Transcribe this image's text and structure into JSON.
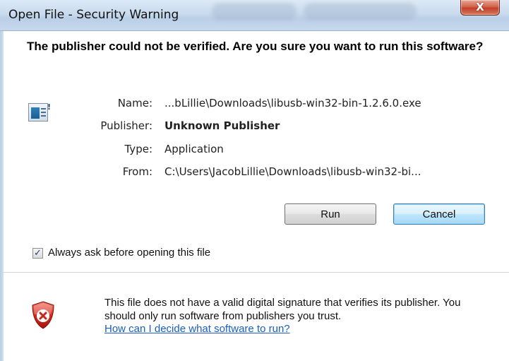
{
  "window": {
    "title": "Open File - Security Warning",
    "close_label": "X"
  },
  "dialog": {
    "heading": "The publisher could not be verified.  Are you sure you want to run this software?",
    "file_info": {
      "name_label": "Name:",
      "name_value": "...bLillie\\Downloads\\libusb-win32-bin-1.2.6.0.exe",
      "publisher_label": "Publisher:",
      "publisher_value": "Unknown Publisher",
      "type_label": "Type:",
      "type_value": "Application",
      "from_label": "From:",
      "from_value": "C:\\Users\\JacobLillie\\Downloads\\libusb-win32-bi..."
    },
    "buttons": {
      "run_label": "Run",
      "cancel_label": "Cancel"
    },
    "checkbox": {
      "label": "Always ask before opening this file",
      "checked": true
    },
    "warning": {
      "text": "This file does not have a valid digital signature that verifies its publisher.  You should only run software from publishers you trust.",
      "link_text": "How can I decide what software to run?"
    }
  },
  "icons": {
    "file": "application-icon",
    "warning": "security-shield-error-icon",
    "check": "checkmark-icon"
  },
  "colors": {
    "link": "#1a5ec2",
    "shield_red": "#d52b1e",
    "default_button_border": "#3c7fb1"
  }
}
